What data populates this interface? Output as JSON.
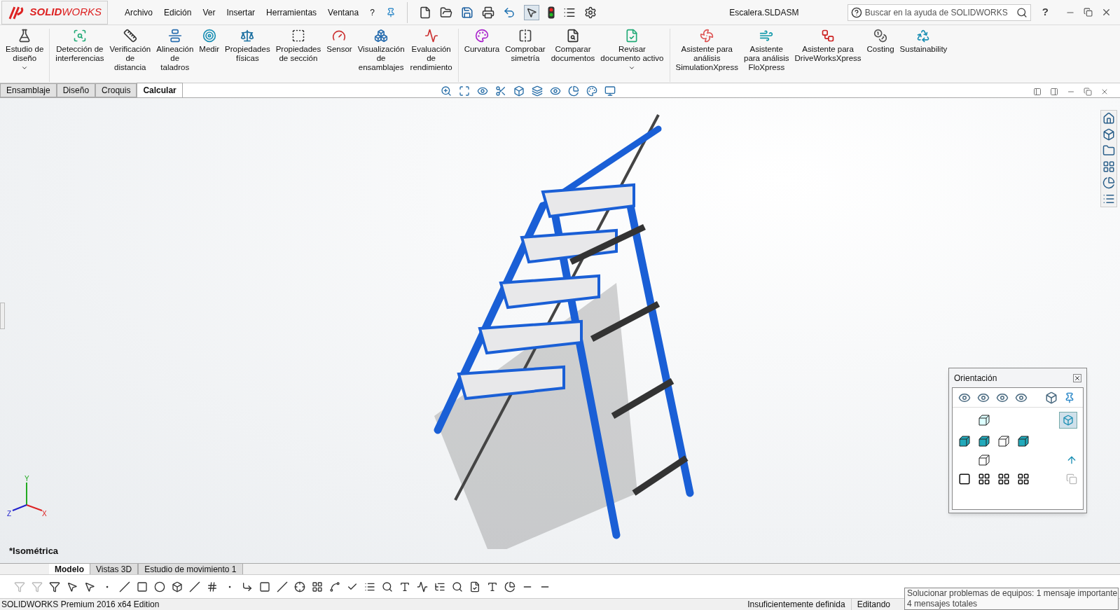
{
  "app": {
    "logo": "**SOLID**WORKS",
    "menu": [
      "Archivo",
      "Edición",
      "Ver",
      "Insertar",
      "Herramientas",
      "Ventana",
      "?"
    ],
    "title": "Escalera.SLDASM",
    "search": {
      "placeholder": "Buscar en la ayuda de SOLIDWORKS"
    },
    "help": "?"
  },
  "ribbon": {
    "groups": [
      [
        {
          "label": "Estudio de\ndiseño",
          "dropdown": true
        }
      ],
      [
        {
          "label": "Detección de\ninterferencias",
          "dropdown": false
        },
        {
          "label": "Verificación\nde\ndistancia",
          "dropdown": false
        },
        {
          "label": "Alineación\nde\ntaladros",
          "dropdown": false
        },
        {
          "label": "Medir",
          "dropdown": false
        },
        {
          "label": "Propiedades\nfísicas",
          "dropdown": false
        },
        {
          "label": "Propiedades\nde sección",
          "dropdown": false
        },
        {
          "label": "Sensor",
          "dropdown": false
        },
        {
          "label": "Visualización\nde\nensamblajes",
          "dropdown": false
        },
        {
          "label": "Evaluación\nde\nrendimiento",
          "dropdown": false
        }
      ],
      [
        {
          "label": "Curvatura",
          "dropdown": false
        },
        {
          "label": "Comprobar\nsimetría",
          "dropdown": false
        },
        {
          "label": "Comparar\ndocumentos",
          "dropdown": false
        },
        {
          "label": "Revisar\ndocumento activo",
          "dropdown": true
        }
      ],
      [
        {
          "label": "Asistente para\nanálisis\nSimulationXpress",
          "dropdown": false
        },
        {
          "label": "Asistente\npara análisis\nFloXpress",
          "dropdown": false
        },
        {
          "label": "Asistente para\nDriveWorksXpress",
          "dropdown": false
        },
        {
          "label": "Costing",
          "dropdown": false
        },
        {
          "label": "Sustainability",
          "dropdown": false
        }
      ]
    ]
  },
  "command_tabs": [
    {
      "label": "Ensamblaje",
      "selected": false
    },
    {
      "label": "Diseño",
      "selected": false
    },
    {
      "label": "Croquis",
      "selected": false
    },
    {
      "label": "Calcular",
      "selected": true
    }
  ],
  "viewport": {
    "view_name": "*Isométrica",
    "triad": [
      "Y",
      "Z",
      "X"
    ]
  },
  "orientation": {
    "title": "Orientación",
    "isometric_selected": true
  },
  "bottom_tabs": [
    {
      "label": "Modelo",
      "selected": true
    },
    {
      "label": "Vistas 3D",
      "selected": false
    },
    {
      "label": "Estudio de movimiento 1",
      "selected": false
    }
  ],
  "status_bar": {
    "edition": "SOLIDWORKS Premium 2016 x64 Edition",
    "state": "Insuficientemente definida",
    "mode": "Editando"
  },
  "tooltip": {
    "lines": [
      "Solucionar problemas de equipos: 1 mensaje importante",
      "4 mensajes totales"
    ]
  }
}
